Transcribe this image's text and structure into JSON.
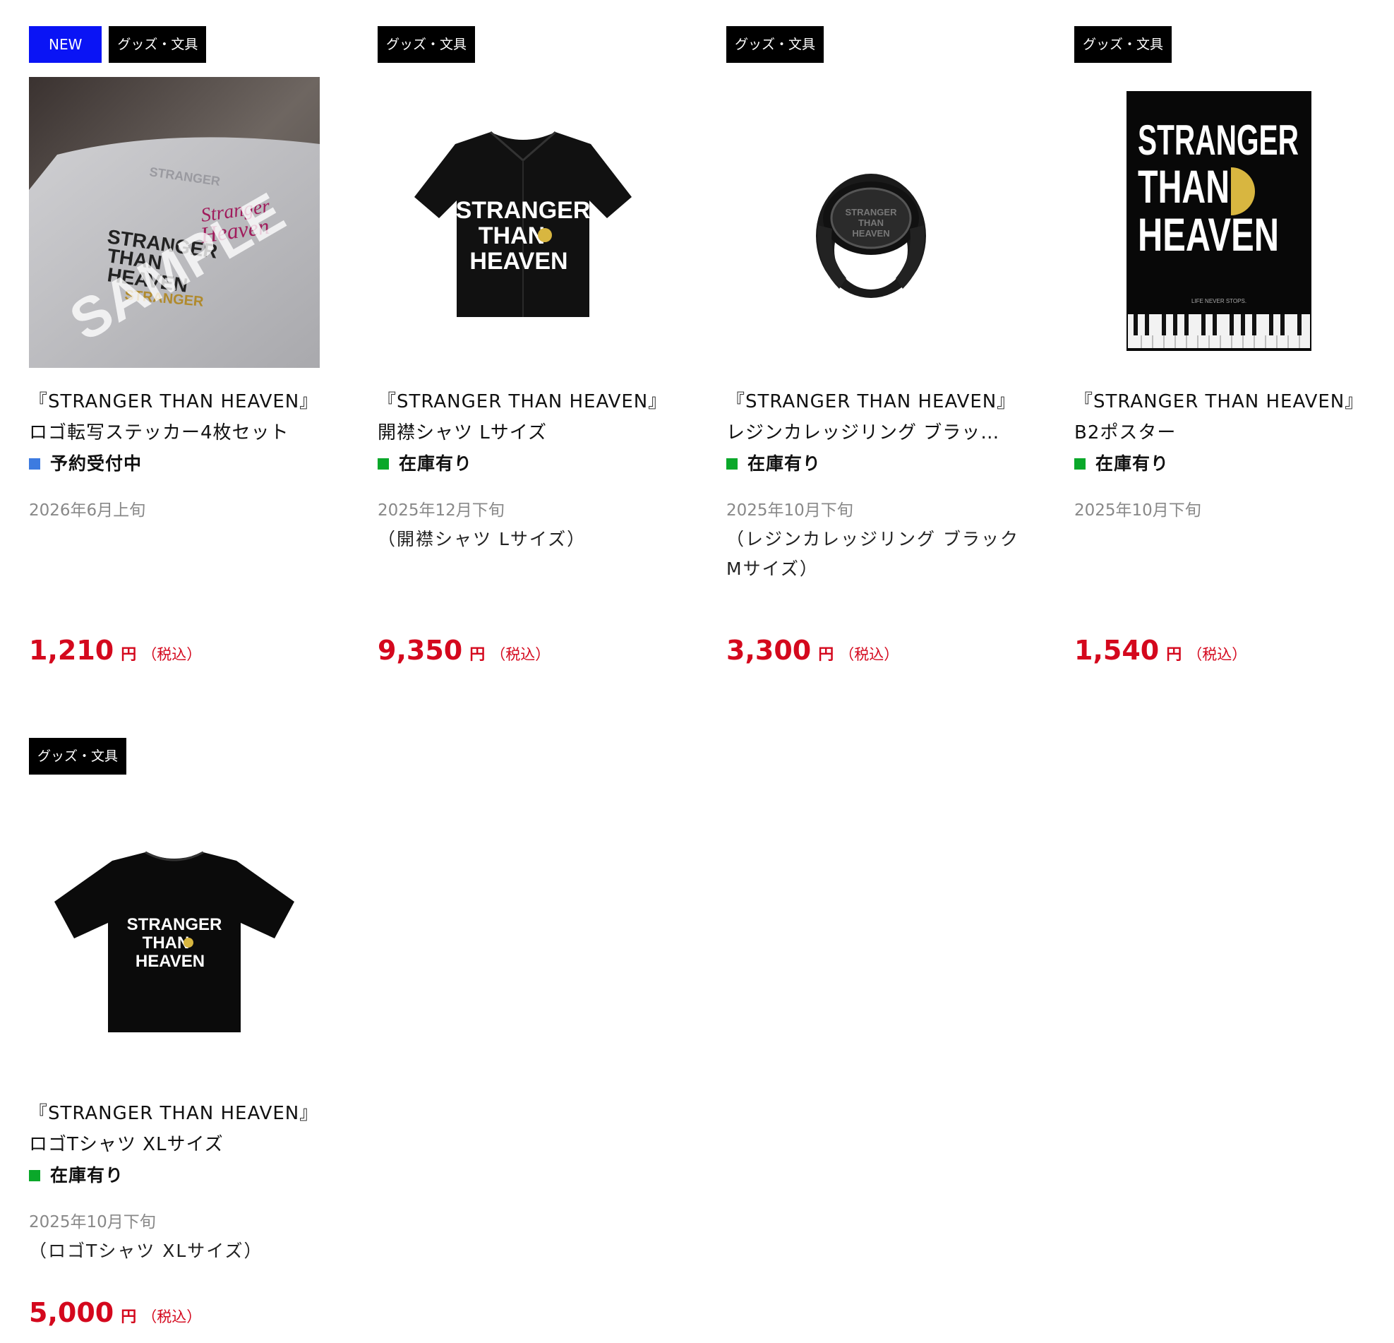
{
  "products": [
    {
      "tags": [
        "NEW",
        "グッズ・文具"
      ],
      "title_line1": "『STRANGER THAN HEAVEN』",
      "title_line2": "ロゴ転写ステッカー4枚セット",
      "status": "予約受付中",
      "status_color": "#3d7be0",
      "date": "2026年6月上旬",
      "variant": "",
      "price": "1,210",
      "yen": "円",
      "tax": "（税込）",
      "image": "sticker-sample-image"
    },
    {
      "tags": [
        "グッズ・文具"
      ],
      "title_line1": "『STRANGER THAN HEAVEN』",
      "title_line2": "開襟シャツ Lサイズ",
      "status": "在庫有り",
      "status_color": "#0aa82a",
      "date": "2025年12月下旬",
      "variant": "（開襟シャツ Lサイズ）",
      "price": "9,350",
      "yen": "円",
      "tax": "（税込）",
      "image": "shirt-image"
    },
    {
      "tags": [
        "グッズ・文具"
      ],
      "title_line1": "『STRANGER THAN HEAVEN』",
      "title_line2": "レジンカレッジリング ブラッ…",
      "status": "在庫有り",
      "status_color": "#0aa82a",
      "date": "2025年10月下旬",
      "variant": "（レジンカレッジリング ブラック Mサイズ）",
      "price": "3,300",
      "yen": "円",
      "tax": "（税込）",
      "image": "ring-image"
    },
    {
      "tags": [
        "グッズ・文具"
      ],
      "title_line1": "『STRANGER THAN HEAVEN』",
      "title_line2": "B2ポスター",
      "status": "在庫有り",
      "status_color": "#0aa82a",
      "date": "2025年10月下旬",
      "variant": "",
      "price": "1,540",
      "yen": "円",
      "tax": "（税込）",
      "image": "poster-image"
    },
    {
      "tags": [
        "グッズ・文具"
      ],
      "title_line1": "『STRANGER THAN HEAVEN』",
      "title_line2": "ロゴTシャツ XLサイズ",
      "status": "在庫有り",
      "status_color": "#0aa82a",
      "date": "2025年10月下旬",
      "variant": "（ロゴTシャツ XLサイズ）",
      "price": "5,000",
      "yen": "円",
      "tax": "（税込）",
      "image": "tshirt-image"
    }
  ],
  "image_text": {
    "logo_l1": "STRANGER",
    "logo_l2": "THAN",
    "logo_l3": "HEAVEN",
    "sample": "SAMPLE",
    "poster_tagline": "LIFE NEVER STOPS."
  },
  "colors": {
    "new_tag": "#0a14f5",
    "tag": "#000000",
    "price": "#d4081d",
    "logo_gold": "#d8b640"
  }
}
